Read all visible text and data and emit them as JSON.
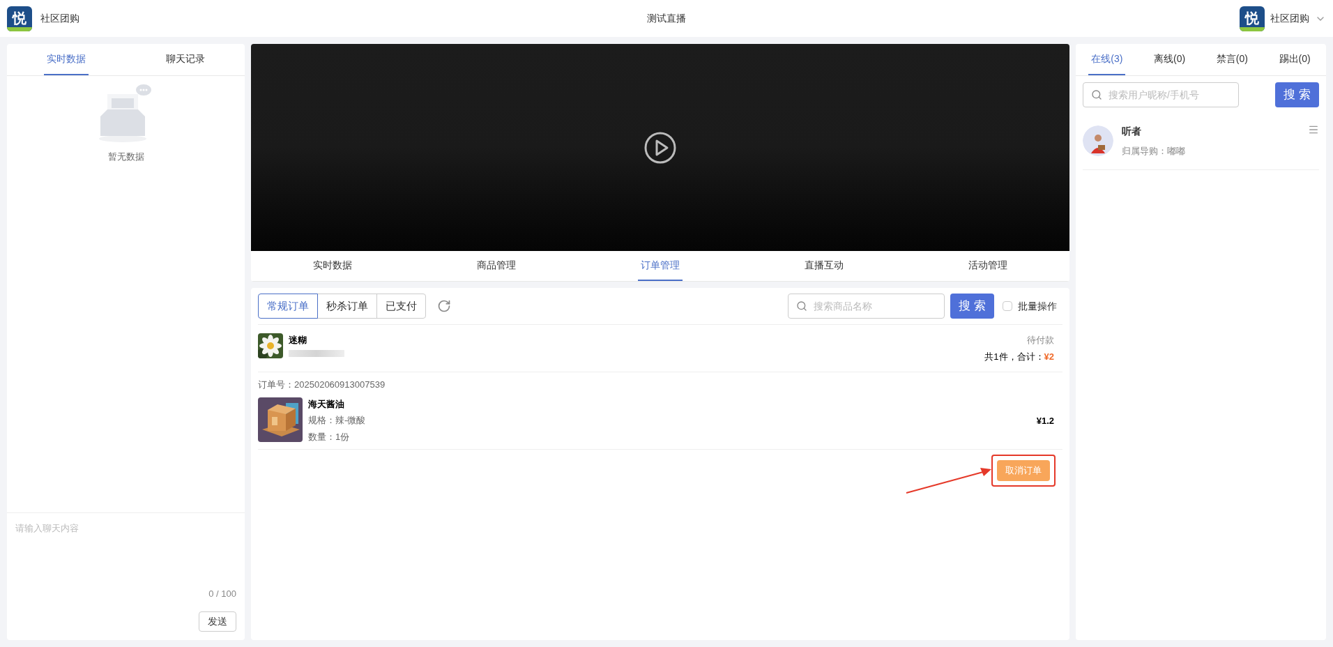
{
  "header": {
    "logo_mark": "悦",
    "app_name": "社区团购",
    "title": "测试直播",
    "account": {
      "logo_mark": "悦",
      "name": "社区团购"
    }
  },
  "left_panel": {
    "tabs": [
      {
        "label": "实时数据",
        "selected": true
      },
      {
        "label": "聊天记录",
        "selected": false
      }
    ],
    "empty_text": "暂无数据",
    "chat_input": {
      "placeholder": "请输入聊天内容",
      "counter": "0 / 100"
    },
    "send_button": "发送"
  },
  "main_tabs": [
    {
      "label": "实时数据",
      "selected": false
    },
    {
      "label": "商品管理",
      "selected": false
    },
    {
      "label": "订单管理",
      "selected": true
    },
    {
      "label": "直播互动",
      "selected": false
    },
    {
      "label": "活动管理",
      "selected": false
    }
  ],
  "order_filters": [
    {
      "label": "常规订单",
      "selected": true
    },
    {
      "label": "秒杀订单",
      "selected": false
    },
    {
      "label": "已支付",
      "selected": false
    }
  ],
  "product_search": {
    "placeholder": "搜索商品名称",
    "button": "搜 索"
  },
  "batch": {
    "label": "批量操作",
    "checked": false
  },
  "orders": [
    {
      "customer": "迷糊",
      "status": "待付款",
      "summary": "共1件，合计：",
      "total": "¥2",
      "order_no": "订单号：202502060913007539",
      "items": [
        {
          "name": "海天酱油",
          "spec": "规格：辣-微酸",
          "quantity": "数量：1份",
          "price": "¥1.2"
        }
      ],
      "action": "取消订单"
    }
  ],
  "right_panel": {
    "tabs": [
      {
        "label": "在线(3)",
        "selected": true
      },
      {
        "label": "离线(0)",
        "selected": false
      },
      {
        "label": "禁言(0)",
        "selected": false
      },
      {
        "label": "踢出(0)",
        "selected": false
      }
    ],
    "search": {
      "placeholder": "搜索用户昵称/手机号",
      "button": "搜 索"
    },
    "users": [
      {
        "name": "听者",
        "guide": "归属导购：嘟嘟"
      }
    ]
  }
}
